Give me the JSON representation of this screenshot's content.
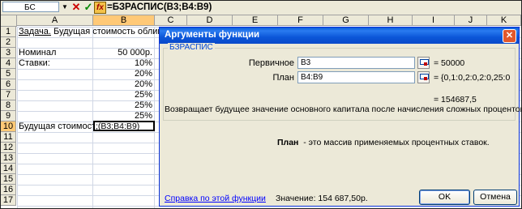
{
  "formula_bar": {
    "name_box": "БС",
    "fx_label": "fx",
    "cancel_symbol": "✕",
    "enter_symbol": "✓",
    "formula": "=БЗРАСПИС(B3;B4:B9)"
  },
  "columns": [
    "A",
    "B",
    "C",
    "D",
    "E",
    "F",
    "G",
    "H",
    "I",
    "J",
    "K"
  ],
  "rows": [
    "1",
    "2",
    "3",
    "4",
    "5",
    "6",
    "7",
    "8",
    "9",
    "10",
    "11",
    "12",
    "13",
    "14",
    "15",
    "16",
    "17"
  ],
  "cells": {
    "a1_part1": "Задача.",
    "a1_part2": " Будущая стоимость облигации",
    "a3": "Номинал",
    "b3": "50 000р.",
    "a4": "Ставки:",
    "b4": "10%",
    "b5": "20%",
    "b6": "20%",
    "b7": "25%",
    "b8": "25%",
    "b9": "25%",
    "a10": "Будущая стоимость:",
    "b10_edit": ";(B3;B4:B9)"
  },
  "dialog": {
    "title": "Аргументы функции",
    "close_symbol": "✕",
    "function_name": "БЗРАСПИС",
    "args": [
      {
        "label": "Первичное",
        "value": "B3",
        "result": "= 50000"
      },
      {
        "label": "План",
        "value": "B4:B9",
        "result": "= {0,1:0,2:0,2:0,25:0"
      }
    ],
    "result": "= 154687,5",
    "description": "Возвращает будущее значение основного капитала после начисления сложных процентов.",
    "arg_help_name": "План",
    "arg_help_text": "  - это массив применяемых процентных ставок.",
    "help_link": "Справка по этой функции",
    "value_line": "Значение: 154 687,50р.",
    "ok_label": "OK",
    "cancel_label": "Отмена"
  }
}
